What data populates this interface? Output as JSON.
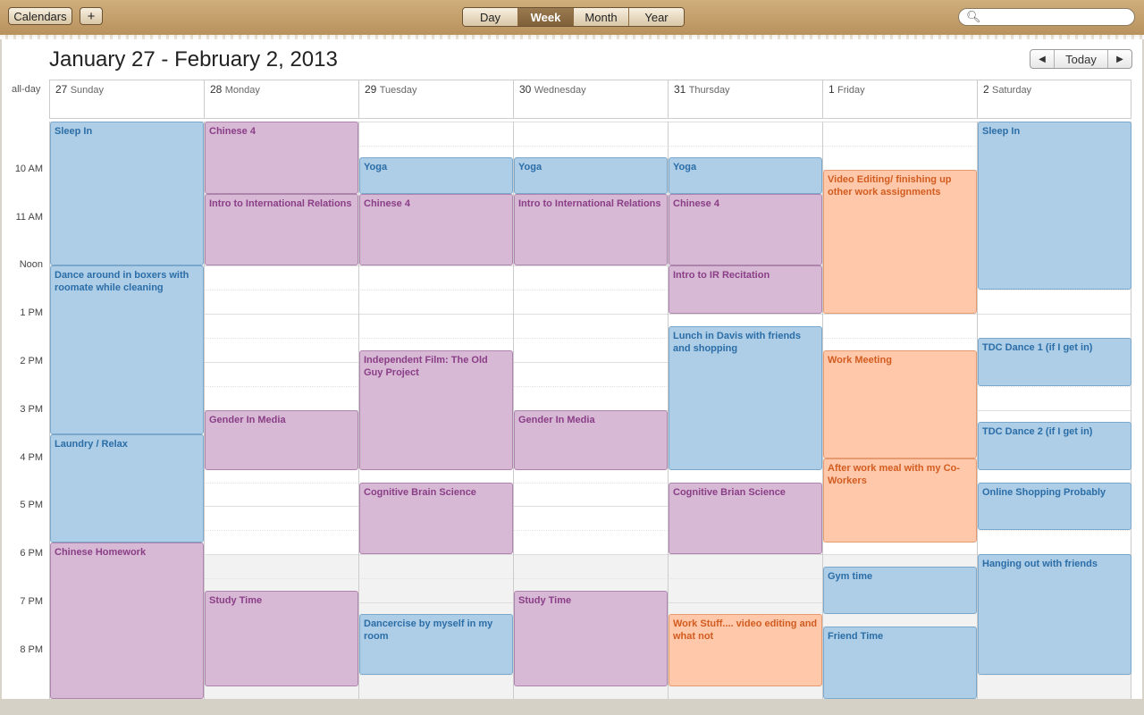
{
  "toolbar": {
    "calendars_label": "Calendars",
    "add_label": "+",
    "views": [
      "Day",
      "Week",
      "Month",
      "Year"
    ],
    "active_view": "Week",
    "search_placeholder": ""
  },
  "header": {
    "title": "January 27 - February 2, 2013",
    "prev_label": "◀",
    "today_label": "Today",
    "next_label": "▶",
    "allday_label": "all-day"
  },
  "days": [
    {
      "num": "27",
      "name": "Sunday"
    },
    {
      "num": "28",
      "name": "Monday"
    },
    {
      "num": "29",
      "name": "Tuesday"
    },
    {
      "num": "30",
      "name": "Wednesday"
    },
    {
      "num": "31",
      "name": "Thursday"
    },
    {
      "num": "1",
      "name": "Friday"
    },
    {
      "num": "2",
      "name": "Saturday"
    }
  ],
  "hours": [
    "10 AM",
    "11 AM",
    "Noon",
    "1 PM",
    "2 PM",
    "3 PM",
    "4 PM",
    "5 PM",
    "6 PM",
    "7 PM",
    "8 PM"
  ],
  "colors": {
    "blue": "#aecde6",
    "purple": "#d7b9d6",
    "orange": "#ffc8aa"
  },
  "events": [
    {
      "day": 0,
      "start": 9.0,
      "end": 12.0,
      "title": "Sleep In",
      "color": "blue"
    },
    {
      "day": 0,
      "start": 12.0,
      "end": 15.5,
      "title": "Dance around in boxers with roomate while cleaning",
      "color": "blue"
    },
    {
      "day": 0,
      "start": 15.5,
      "end": 17.75,
      "title": "Laundry / Relax",
      "color": "blue"
    },
    {
      "day": 0,
      "start": 17.75,
      "end": 21.0,
      "title": "Chinese Homework",
      "color": "purple"
    },
    {
      "day": 1,
      "start": 9.0,
      "end": 10.5,
      "title": "Chinese 4",
      "color": "purple"
    },
    {
      "day": 1,
      "start": 10.5,
      "end": 12.0,
      "title": "Intro to International Relations",
      "color": "purple"
    },
    {
      "day": 1,
      "start": 15.0,
      "end": 16.25,
      "title": "Gender In Media",
      "color": "purple"
    },
    {
      "day": 1,
      "start": 18.75,
      "end": 20.75,
      "title": "Study Time",
      "color": "purple"
    },
    {
      "day": 2,
      "start": 9.75,
      "end": 10.5,
      "title": "Yoga",
      "color": "blue"
    },
    {
      "day": 2,
      "start": 10.5,
      "end": 12.0,
      "title": "Chinese 4",
      "color": "purple"
    },
    {
      "day": 2,
      "start": 13.75,
      "end": 16.25,
      "title": "Independent Film: The Old Guy Project",
      "color": "purple"
    },
    {
      "day": 2,
      "start": 16.5,
      "end": 18.0,
      "title": "Cognitive Brain Science",
      "color": "purple"
    },
    {
      "day": 2,
      "start": 19.25,
      "end": 20.5,
      "title": "Dancercise by myself in my room",
      "color": "blue"
    },
    {
      "day": 3,
      "start": 9.75,
      "end": 10.5,
      "title": "Yoga",
      "color": "blue"
    },
    {
      "day": 3,
      "start": 10.5,
      "end": 12.0,
      "title": "Intro to International Relations",
      "color": "purple"
    },
    {
      "day": 3,
      "start": 15.0,
      "end": 16.25,
      "title": "Gender In Media",
      "color": "purple"
    },
    {
      "day": 3,
      "start": 18.75,
      "end": 20.75,
      "title": "Study Time",
      "color": "purple"
    },
    {
      "day": 4,
      "start": 9.75,
      "end": 10.5,
      "title": "Yoga",
      "color": "blue"
    },
    {
      "day": 4,
      "start": 10.5,
      "end": 12.0,
      "title": "Chinese 4",
      "color": "purple"
    },
    {
      "day": 4,
      "start": 12.0,
      "end": 13.0,
      "title": "Intro to IR Recitation",
      "color": "purple"
    },
    {
      "day": 4,
      "start": 13.25,
      "end": 16.25,
      "title": "Lunch in Davis with friends and shopping",
      "color": "blue"
    },
    {
      "day": 4,
      "start": 16.5,
      "end": 18.0,
      "title": "Cognitive Brian Science",
      "color": "purple"
    },
    {
      "day": 4,
      "start": 19.25,
      "end": 20.75,
      "title": "Work Stuff.... video editing and what not",
      "color": "orange"
    },
    {
      "day": 5,
      "start": 10.0,
      "end": 13.0,
      "title": "Video Editing/ finishing up other work assignments",
      "color": "orange"
    },
    {
      "day": 5,
      "start": 13.75,
      "end": 16.0,
      "title": "Work Meeting",
      "color": "orange"
    },
    {
      "day": 5,
      "start": 16.0,
      "end": 17.75,
      "title": "After work meal with my Co-Workers",
      "color": "orange"
    },
    {
      "day": 5,
      "start": 18.25,
      "end": 19.25,
      "title": "Gym time",
      "color": "blue"
    },
    {
      "day": 5,
      "start": 19.5,
      "end": 21.0,
      "title": "Friend Time",
      "color": "blue"
    },
    {
      "day": 6,
      "start": 9.0,
      "end": 12.5,
      "title": "Sleep In",
      "color": "blue"
    },
    {
      "day": 6,
      "start": 13.5,
      "end": 14.5,
      "title": "TDC Dance 1 (if I get in)",
      "color": "blue"
    },
    {
      "day": 6,
      "start": 15.25,
      "end": 16.25,
      "title": "TDC Dance 2 (if I get in)",
      "color": "blue"
    },
    {
      "day": 6,
      "start": 16.5,
      "end": 17.5,
      "title": "Online Shopping Probably",
      "color": "blue"
    },
    {
      "day": 6,
      "start": 18.0,
      "end": 20.5,
      "title": "Hanging out with friends",
      "color": "blue"
    }
  ]
}
